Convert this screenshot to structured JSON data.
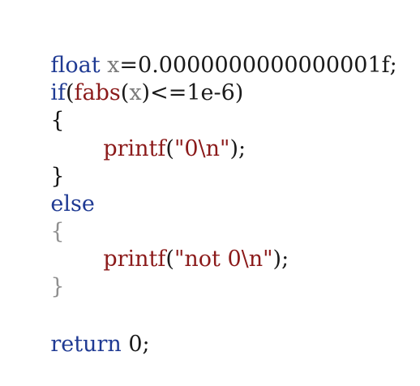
{
  "code": {
    "line1": {
      "kw": "float",
      "var": "x",
      "rest": "=0.0000000000000001f;"
    },
    "line2": {
      "kw": "if",
      "open": "(",
      "fn": "fabs",
      "argopen": "(",
      "var": "x",
      "argclose": ")",
      "rest": "<=1e-6)"
    },
    "line3": {
      "brace": "{"
    },
    "line4": {
      "fn": "printf",
      "open": "(",
      "str": "\"0\\n\"",
      "close": ");"
    },
    "line5": {
      "brace": "}"
    },
    "line6": {
      "kw": "else"
    },
    "line7": {
      "brace": "{"
    },
    "line8": {
      "fn": "printf",
      "open": "(",
      "str": "\"not 0\\n\"",
      "close": ");"
    },
    "line9": {
      "brace": "}"
    },
    "line10": {
      "kw": "return",
      "rest": " 0;"
    }
  }
}
